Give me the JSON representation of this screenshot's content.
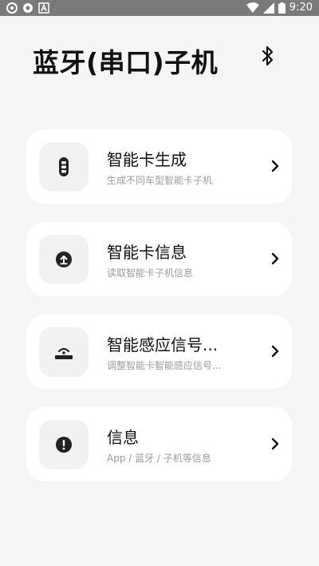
{
  "status_bar": {
    "time": "9:20",
    "left_icons": [
      "sync-icon",
      "settings-icon",
      "a-icon"
    ],
    "right_icons": [
      "wifi-icon",
      "signal-icon",
      "battery-icon"
    ]
  },
  "header": {
    "title": "蓝牙(串口)子机",
    "action_icon": "bluetooth-icon"
  },
  "menu": [
    {
      "title": "智能卡生成",
      "subtitle": "生成不同车型智能卡子机",
      "icon": "car-key-icon"
    },
    {
      "title": "智能卡信息",
      "subtitle": "读取智能卡子机信息",
      "icon": "upload-icon"
    },
    {
      "title": "智能感应信号...",
      "subtitle": "调整智能卡智能感应信号...",
      "icon": "signal-sensor-icon"
    },
    {
      "title": "信息",
      "subtitle": "App / 蓝牙 / 子机等信息",
      "icon": "info-icon"
    }
  ],
  "colors": {
    "background": "#f5f5f5",
    "card": "#ffffff",
    "icon_bg": "#f1f1f1",
    "status_bar": "#7a7a7a",
    "subtitle": "#9a9a9a"
  }
}
